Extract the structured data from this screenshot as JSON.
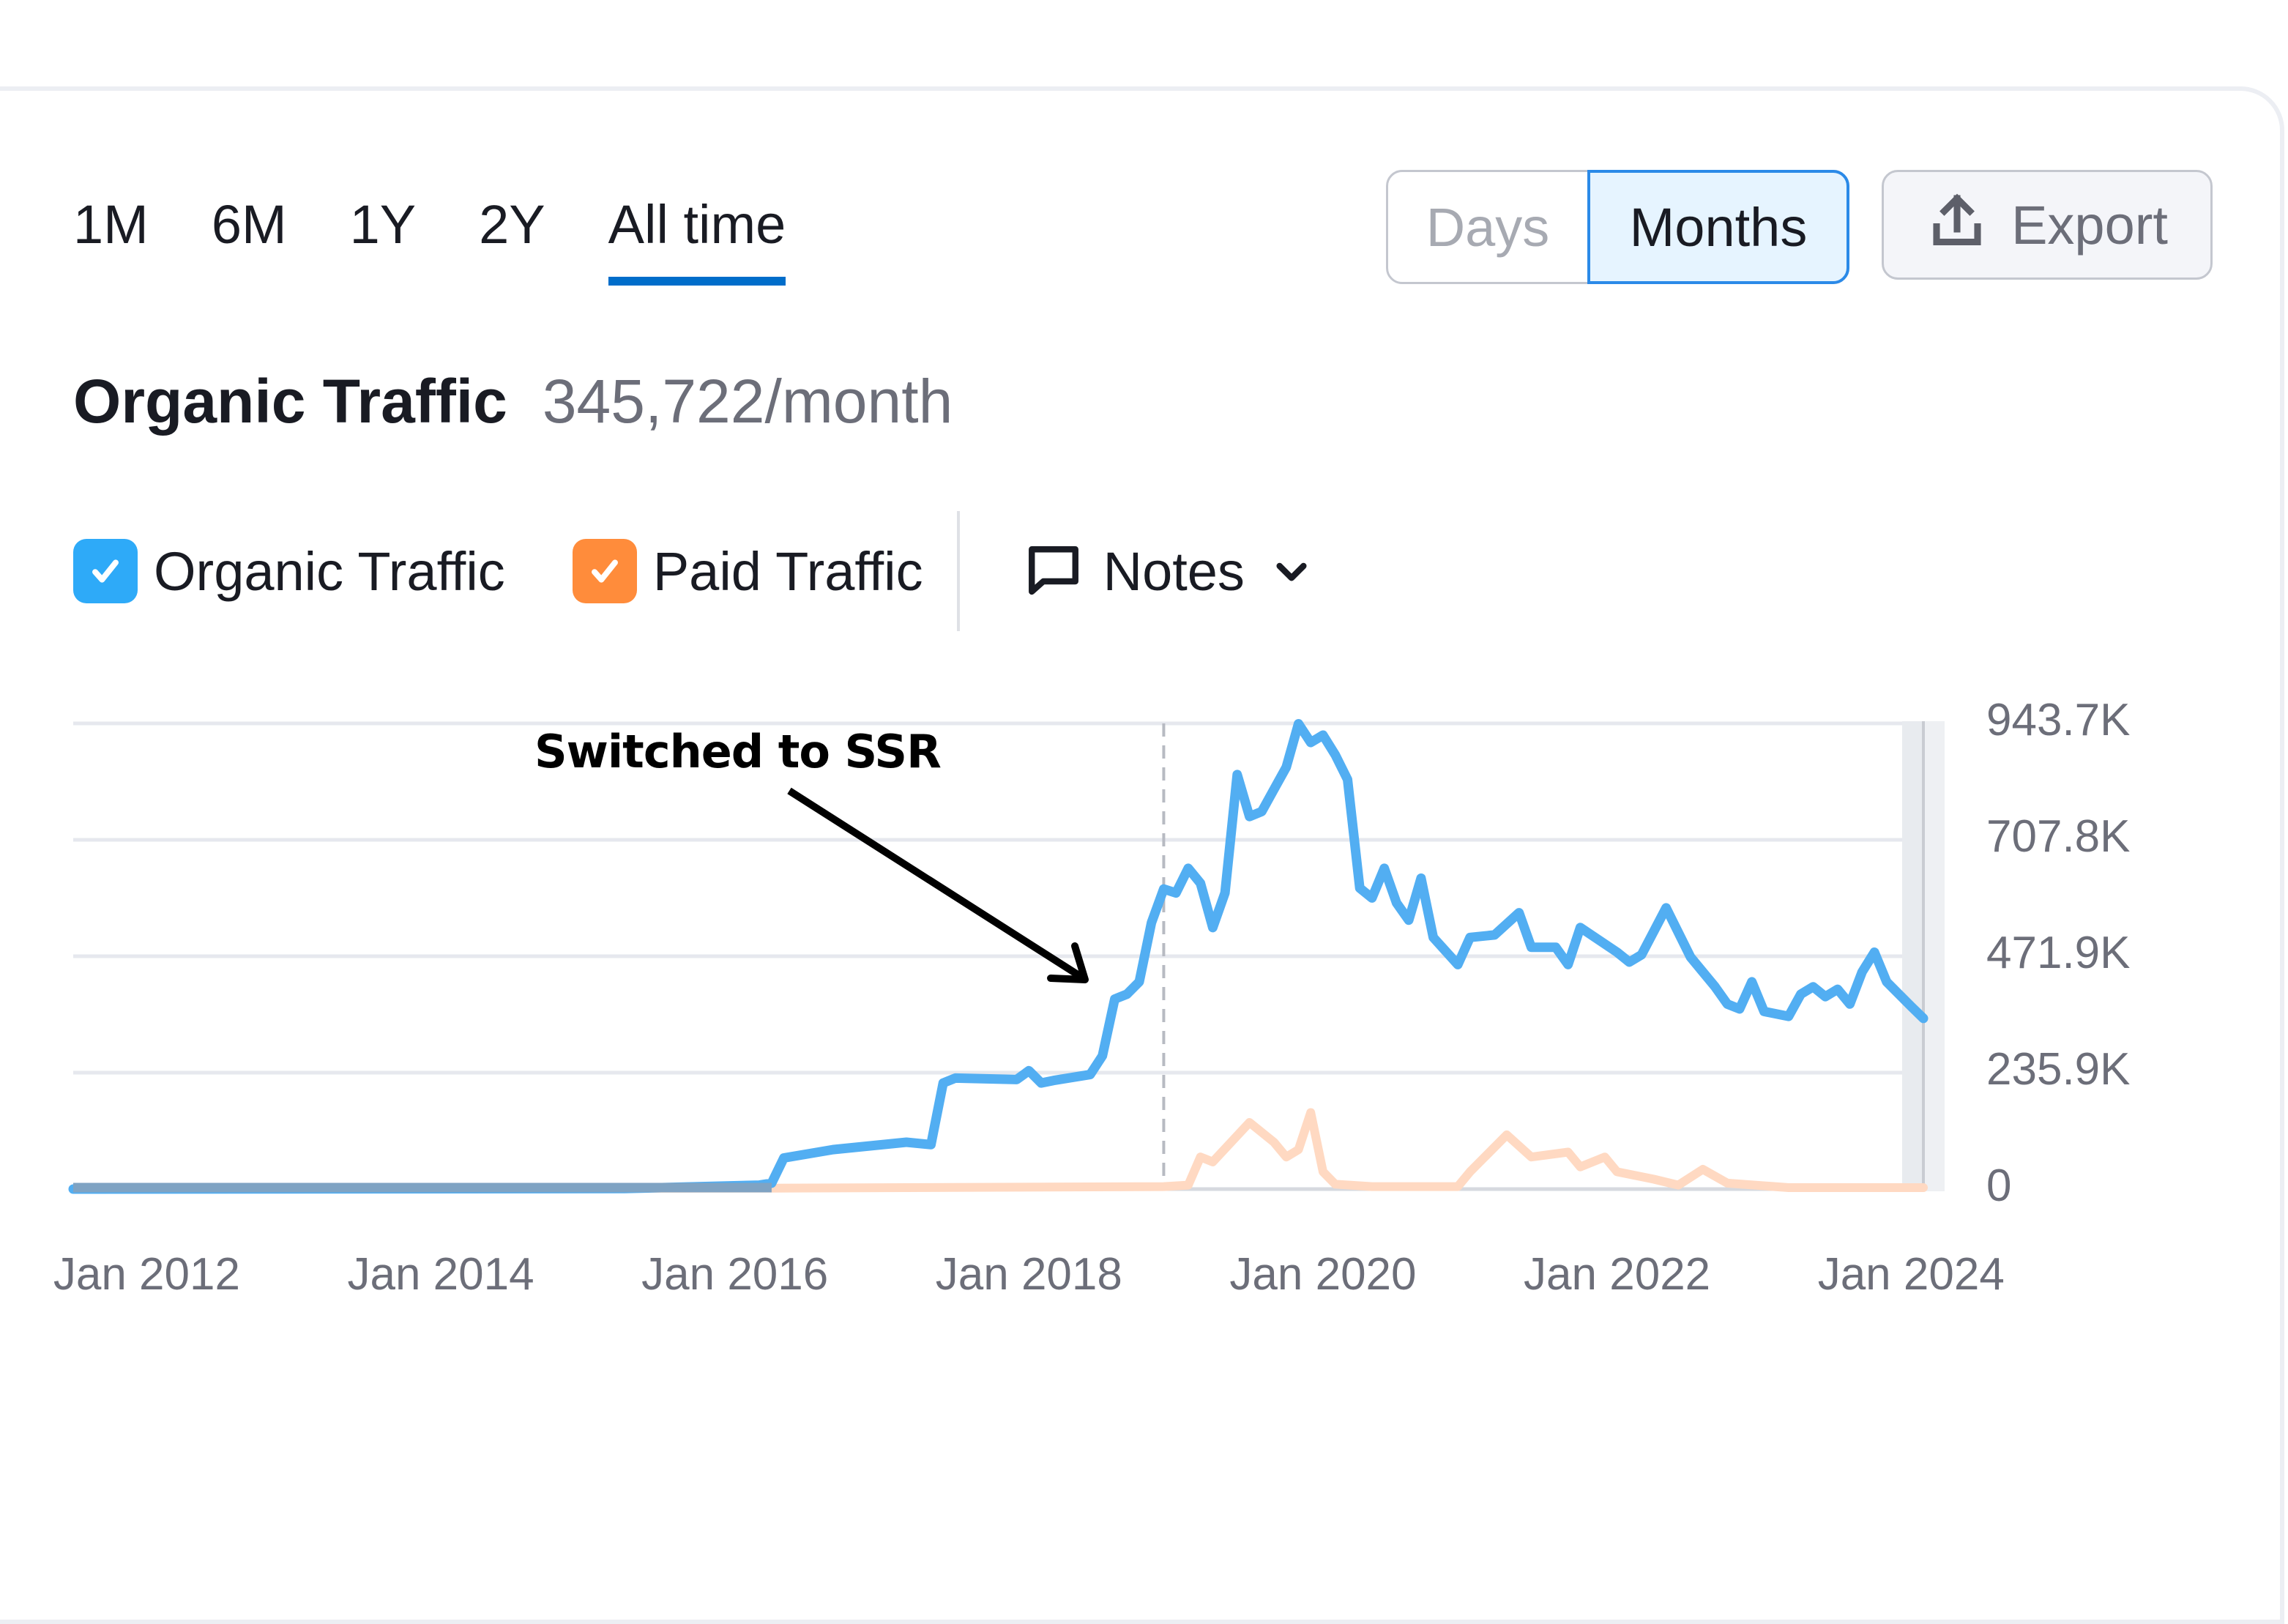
{
  "periods": {
    "items": [
      "1M",
      "6M",
      "1Y",
      "2Y",
      "All time"
    ],
    "active": "All time"
  },
  "granularity": {
    "days_label": "Days",
    "months_label": "Months",
    "selected": "Months"
  },
  "export": {
    "label": "Export",
    "icon": "upload-icon"
  },
  "header": {
    "title": "Organic Traffic",
    "value": "345,722/month"
  },
  "legend": {
    "organic": {
      "label": "Organic Traffic",
      "checked": true,
      "color": "#2eaaf8"
    },
    "paid": {
      "label": "Paid Traffic",
      "checked": true,
      "color": "#ff8c3b"
    },
    "notes": {
      "label": "Notes",
      "icon": "comment-icon",
      "chevron": "chevron-down-icon"
    }
  },
  "annotation": {
    "text": "Switched to SSR",
    "marker_date": "2018-12"
  },
  "colors": {
    "organic_line": "#52aef2",
    "paid_line": "#ffd9c2",
    "grid": "#e6e8ee",
    "axis_text": "#6c6e79",
    "accent": "#006dca"
  },
  "chart_data": {
    "type": "line",
    "title": "Organic Traffic",
    "xlabel": "",
    "ylabel": "",
    "x_range": [
      "2011-07",
      "2024-02"
    ],
    "ylim": [
      0,
      943700
    ],
    "y_ticks": [
      {
        "value": 943700,
        "label": "943.7K"
      },
      {
        "value": 707800,
        "label": "707.8K"
      },
      {
        "value": 471900,
        "label": "471.9K"
      },
      {
        "value": 235900,
        "label": "235.9K"
      },
      {
        "value": 0,
        "label": "0"
      }
    ],
    "x_ticks": [
      {
        "date": "2012-01",
        "label": "Jan 2012"
      },
      {
        "date": "2014-01",
        "label": "Jan 2014"
      },
      {
        "date": "2016-01",
        "label": "Jan 2016"
      },
      {
        "date": "2018-01",
        "label": "Jan 2018"
      },
      {
        "date": "2020-01",
        "label": "Jan 2020"
      },
      {
        "date": "2022-01",
        "label": "Jan 2022"
      },
      {
        "date": "2024-01",
        "label": "Jan 2024"
      }
    ],
    "grid": true,
    "legend_position": "top-left",
    "series": [
      {
        "name": "Organic Traffic",
        "points": [
          [
            "2011-07",
            0
          ],
          [
            "2015-04",
            1000
          ],
          [
            "2016-03",
            8000
          ],
          [
            "2016-04",
            12000
          ],
          [
            "2016-05",
            63000
          ],
          [
            "2016-09",
            80000
          ],
          [
            "2017-03",
            95000
          ],
          [
            "2017-05",
            90000
          ],
          [
            "2017-06",
            215000
          ],
          [
            "2017-07",
            225000
          ],
          [
            "2017-12",
            222000
          ],
          [
            "2018-01",
            240000
          ],
          [
            "2018-02",
            215000
          ],
          [
            "2018-03",
            220000
          ],
          [
            "2018-06",
            232000
          ],
          [
            "2018-07",
            270000
          ],
          [
            "2018-08",
            385000
          ],
          [
            "2018-09",
            395000
          ],
          [
            "2018-10",
            420000
          ],
          [
            "2018-11",
            540000
          ],
          [
            "2018-12",
            608000
          ],
          [
            "2019-01",
            600000
          ],
          [
            "2019-02",
            650000
          ],
          [
            "2019-03",
            620000
          ],
          [
            "2019-04",
            530000
          ],
          [
            "2019-05",
            600000
          ],
          [
            "2019-06",
            840000
          ],
          [
            "2019-07",
            755000
          ],
          [
            "2019-08",
            765000
          ],
          [
            "2019-09",
            810000
          ],
          [
            "2019-10",
            855000
          ],
          [
            "2019-11",
            943000
          ],
          [
            "2019-12",
            905000
          ],
          [
            "2020-01",
            920000
          ],
          [
            "2020-02",
            880000
          ],
          [
            "2020-03",
            830000
          ],
          [
            "2020-04",
            610000
          ],
          [
            "2020-05",
            590000
          ],
          [
            "2020-06",
            650000
          ],
          [
            "2020-07",
            580000
          ],
          [
            "2020-08",
            545000
          ],
          [
            "2020-09",
            630000
          ],
          [
            "2020-10",
            510000
          ],
          [
            "2020-12",
            455000
          ],
          [
            "2021-01",
            510000
          ],
          [
            "2021-03",
            515000
          ],
          [
            "2021-05",
            560000
          ],
          [
            "2021-06",
            490000
          ],
          [
            "2021-08",
            490000
          ],
          [
            "2021-09",
            455000
          ],
          [
            "2021-10",
            530000
          ],
          [
            "2022-01",
            480000
          ],
          [
            "2022-02",
            460000
          ],
          [
            "2022-03",
            475000
          ],
          [
            "2022-05",
            570000
          ],
          [
            "2022-07",
            470000
          ],
          [
            "2022-09",
            410000
          ],
          [
            "2022-10",
            375000
          ],
          [
            "2022-11",
            365000
          ],
          [
            "2022-12",
            420000
          ],
          [
            "2023-01",
            360000
          ],
          [
            "2023-03",
            350000
          ],
          [
            "2023-04",
            395000
          ],
          [
            "2023-05",
            410000
          ],
          [
            "2023-06",
            390000
          ],
          [
            "2023-07",
            405000
          ],
          [
            "2023-08",
            375000
          ],
          [
            "2023-09",
            440000
          ],
          [
            "2023-10",
            480000
          ],
          [
            "2023-11",
            420000
          ],
          [
            "2024-01",
            370000
          ],
          [
            "2024-02",
            346000
          ]
        ]
      },
      {
        "name": "Paid Traffic",
        "points": [
          [
            "2011-07",
            0
          ],
          [
            "2016-04",
            2000
          ],
          [
            "2018-12",
            5000
          ],
          [
            "2019-02",
            8000
          ],
          [
            "2019-03",
            65000
          ],
          [
            "2019-04",
            55000
          ],
          [
            "2019-07",
            135000
          ],
          [
            "2019-09",
            95000
          ],
          [
            "2019-10",
            65000
          ],
          [
            "2019-11",
            80000
          ],
          [
            "2019-12",
            155000
          ],
          [
            "2020-01",
            35000
          ],
          [
            "2020-02",
            10000
          ],
          [
            "2020-05",
            5000
          ],
          [
            "2020-12",
            5000
          ],
          [
            "2021-01",
            35000
          ],
          [
            "2021-04",
            110000
          ],
          [
            "2021-06",
            65000
          ],
          [
            "2021-09",
            75000
          ],
          [
            "2021-10",
            45000
          ],
          [
            "2021-12",
            65000
          ],
          [
            "2022-01",
            35000
          ],
          [
            "2022-04",
            20000
          ],
          [
            "2022-06",
            8000
          ],
          [
            "2022-08",
            40000
          ],
          [
            "2022-10",
            12000
          ],
          [
            "2023-03",
            3000
          ],
          [
            "2024-02",
            3000
          ]
        ]
      }
    ],
    "annotations": [
      {
        "text": "Switched to SSR",
        "date": "2018-12",
        "type": "vertical-dashed-line-with-arrow"
      }
    ]
  }
}
